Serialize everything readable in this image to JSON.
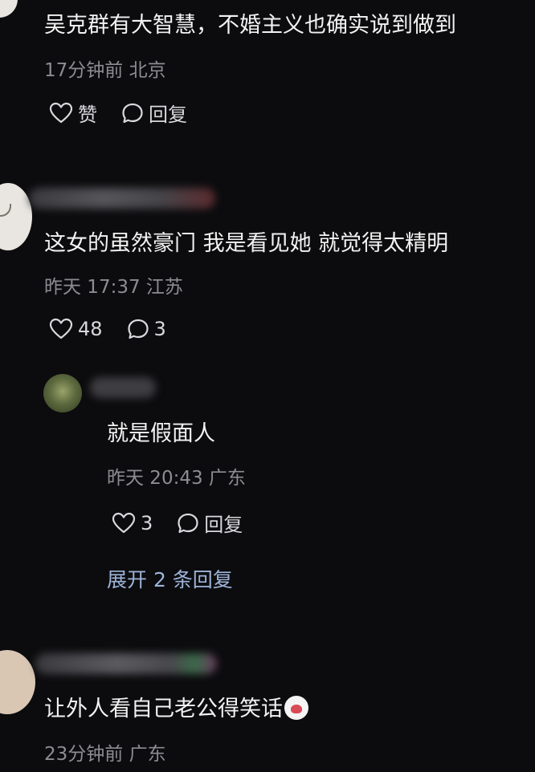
{
  "comments": [
    {
      "text": "吴克群有大智慧，不婚主义也确实说到做到",
      "meta": "17分钟前 北京",
      "like_label": "赞",
      "reply_label": "回复"
    },
    {
      "text": "这女的虽然豪门 我是看见她 就觉得太精明",
      "meta": "昨天 17:37 江苏",
      "like_count": "48",
      "reply_count": "3",
      "reply": {
        "text": "就是假面人",
        "meta": "昨天 20:43 广东",
        "like_count": "3",
        "reply_label": "回复"
      },
      "expand_label": "展开 2 条回复"
    },
    {
      "text": "让外人看自己老公得笑话",
      "meta": "23分钟前 广东"
    }
  ],
  "icons": {
    "like": "heart-outline-icon",
    "comment": "speech-bubble-icon",
    "emoji": "crying-face-emoji"
  },
  "colors": {
    "background": "#0c0c0e",
    "text": "#f2f2f2",
    "meta": "#8c8c92",
    "link": "#9db4d9"
  }
}
